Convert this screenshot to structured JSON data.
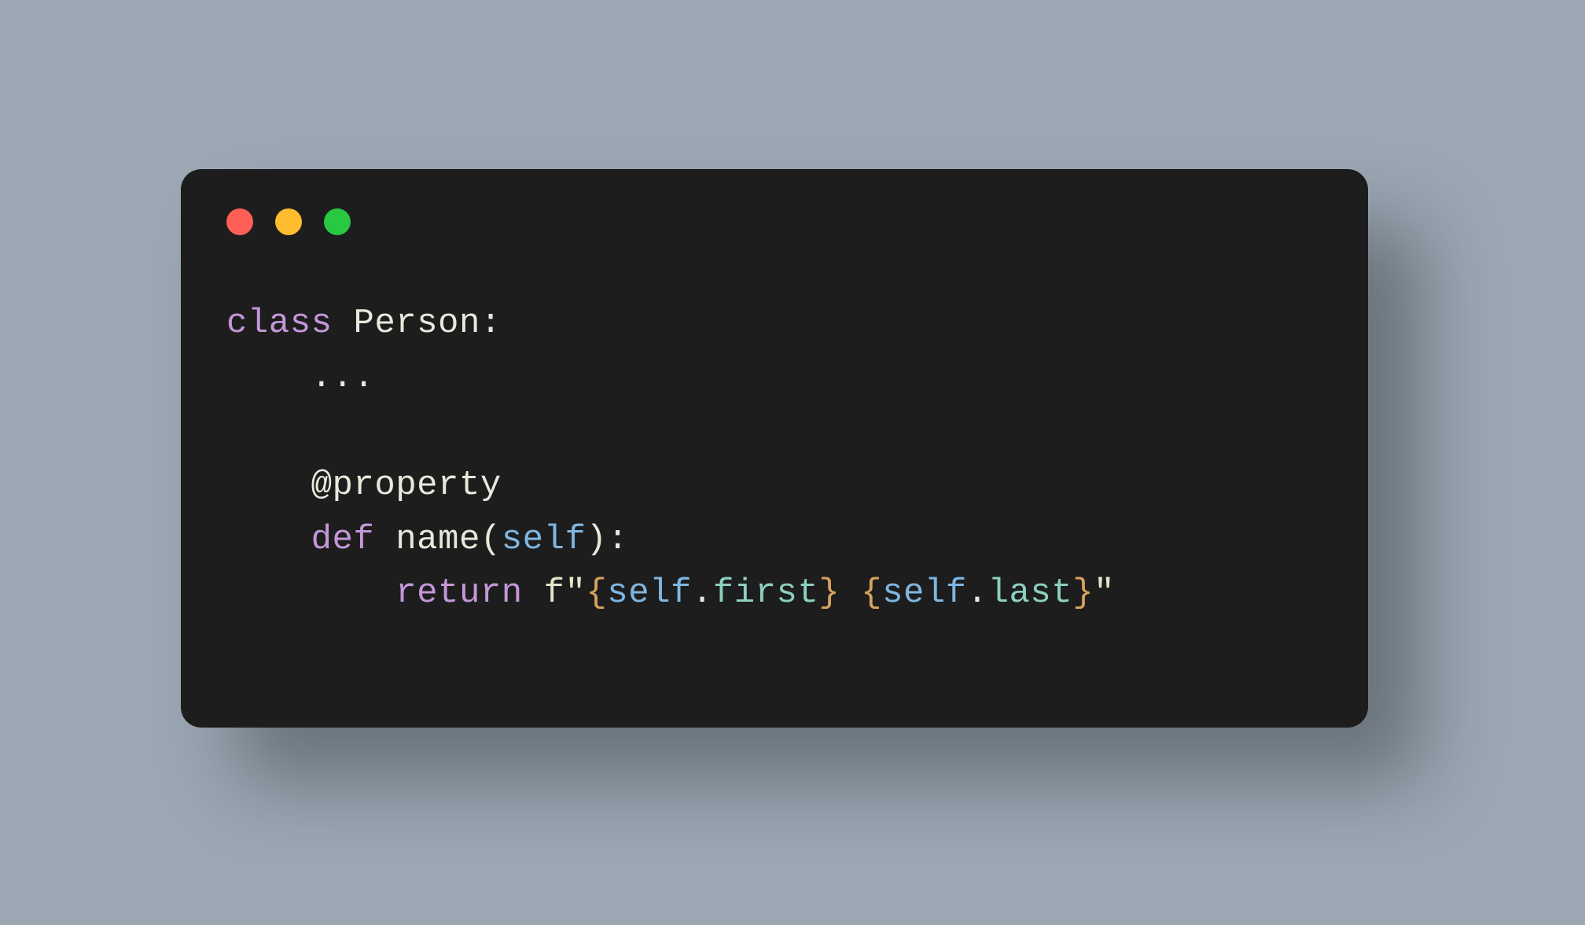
{
  "window": {
    "traffic_lights": [
      "close",
      "minimize",
      "zoom"
    ]
  },
  "code": {
    "tokens": {
      "kw_class": "class",
      "cls_name": "Person",
      "colon": ":",
      "ellipsis": "...",
      "decorator": "@property",
      "kw_def": "def",
      "fn_name": "name",
      "lparen": "(",
      "self": "self",
      "rparen": ")",
      "kw_return": "return",
      "f_prefix": "f",
      "dq": "\"",
      "lbrace": "{",
      "dot": ".",
      "attr_first": "first",
      "rbrace": "}",
      "space": " ",
      "attr_last": "last"
    },
    "indent": {
      "one": "    ",
      "two": "        "
    }
  }
}
